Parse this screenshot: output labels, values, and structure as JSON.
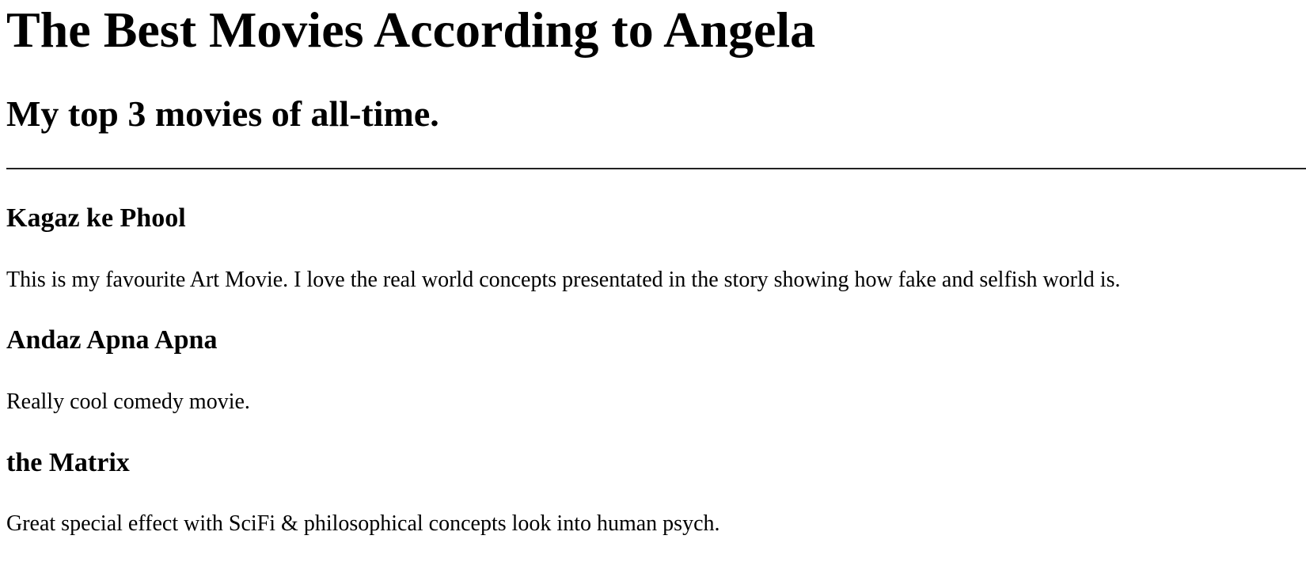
{
  "header": {
    "title": "The Best Movies According to Angela",
    "subtitle": "My top 3 movies of all-time."
  },
  "movies": [
    {
      "title": "Kagaz ke Phool",
      "description": "This is my favourite Art Movie. I love the real world concepts presentated in the story showing how fake and selfish world is."
    },
    {
      "title": "Andaz Apna Apna",
      "description": "Really cool comedy movie."
    },
    {
      "title": "the Matrix",
      "description": "Great special effect with SciFi & philosophical concepts look into human psych."
    }
  ]
}
